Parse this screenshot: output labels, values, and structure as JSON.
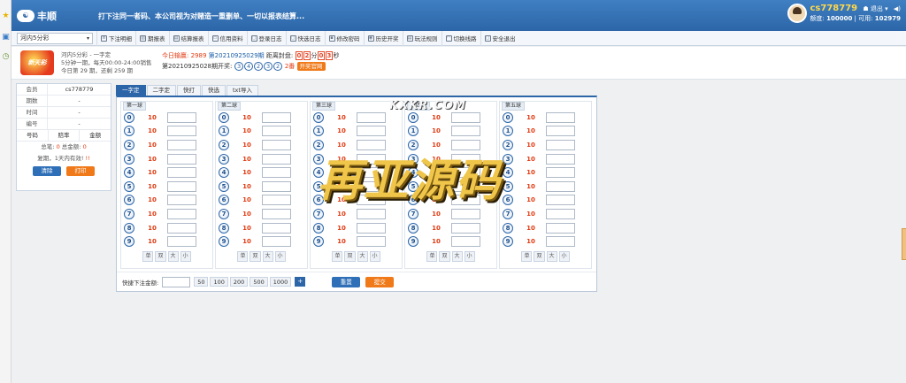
{
  "app": {
    "name": "丰顺",
    "marquee": "打下注同一者码、本公司视为对赌造一重删单、一切以报表结算..."
  },
  "user": {
    "username": "cs778779",
    "logout_label": "退出",
    "quota_label": "额度:",
    "quota": "100000",
    "available_label": "可用:",
    "available": "102979"
  },
  "nav": {
    "game_select": "河内5分彩",
    "items": [
      {
        "label": "下注明细",
        "icon": "list-icon"
      },
      {
        "label": "期报表",
        "icon": "chart-icon"
      },
      {
        "label": "结算报表",
        "icon": "report-icon"
      },
      {
        "label": "信用资料",
        "icon": "card-icon"
      },
      {
        "label": "登录日志",
        "icon": "login-icon"
      },
      {
        "label": "快选日志",
        "icon": "screen-icon"
      },
      {
        "label": "修改密码",
        "icon": "lock-icon"
      },
      {
        "label": "历史开奖",
        "icon": "history-icon"
      },
      {
        "label": "玩法规则",
        "icon": "rules-icon"
      },
      {
        "label": "切换线路",
        "icon": "wifi-icon"
      },
      {
        "label": "安全退出",
        "icon": "exit-icon"
      }
    ]
  },
  "game": {
    "logo_text": "新天彩",
    "title": "河内5分彩 - 一字定",
    "schedule": "5分钟一期，每天00:00-24:00销售",
    "today": "今日第 29 期，还剩 259 期",
    "profit_label": "今日输赢:",
    "profit": "2989",
    "current_period": "第20210925029期",
    "close_label": "距离封盘:",
    "countdown": [
      "0",
      "2",
      "分",
      "0",
      "3",
      "秒"
    ],
    "last_period_label": "第20210925028期开奖:",
    "results": [
      "3",
      "4",
      "2",
      "3",
      "2"
    ],
    "result_extra": "2番",
    "official_btn": "开奖官网"
  },
  "member": {
    "rows": [
      {
        "k": "会员",
        "v": "cs778779"
      },
      {
        "k": "期数",
        "v": "-"
      },
      {
        "k": "时间",
        "v": "-"
      },
      {
        "k": "编号",
        "v": "-"
      }
    ],
    "headers": [
      "号码",
      "赔率",
      "金额"
    ],
    "total_label": "总笔:",
    "total_count": "0",
    "total_amount_label": "总金额:",
    "total_amount": "0",
    "expire_text": "复期，1天内有效!",
    "expire_extra": "!!",
    "clear_btn": "清除",
    "print_btn": "打印"
  },
  "tabs": [
    "一字定",
    "二字定",
    "快打",
    "快选",
    "txt导入"
  ],
  "columns": [
    {
      "title": "第一球"
    },
    {
      "title": "第二球"
    },
    {
      "title": "第三球"
    },
    {
      "title": "第四球"
    },
    {
      "title": "第五球"
    }
  ],
  "numbers": [
    "0",
    "1",
    "2",
    "3",
    "4",
    "5",
    "6",
    "7",
    "8",
    "9"
  ],
  "odds": "10",
  "quick_labels": [
    "单",
    "双",
    "大",
    "小"
  ],
  "bottom": {
    "label": "快捷下注金额:",
    "chips": [
      "50",
      "100",
      "200",
      "500",
      "1000"
    ],
    "plus": "+",
    "reset": "重置",
    "submit": "提交"
  },
  "watermark": {
    "url": "KXKR.COM",
    "text": "再亚源码"
  }
}
